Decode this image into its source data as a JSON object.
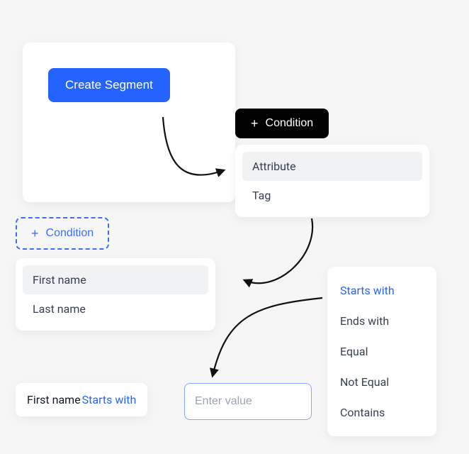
{
  "create_card": {
    "button_label": "Create Segment"
  },
  "black_condition": {
    "label": "Condition",
    "plus": "+"
  },
  "type_menu": {
    "options": [
      "Attribute",
      "Tag"
    ],
    "selected": "Attribute"
  },
  "dashed_condition": {
    "label": "Condition",
    "plus": "+"
  },
  "attribute_menu": {
    "options": [
      "First name",
      "Last name"
    ],
    "selected": "First name"
  },
  "operator_menu": {
    "options": [
      "Starts with",
      "Ends with",
      "Equal",
      "Not Equal",
      "Contains"
    ],
    "selected": "Starts with"
  },
  "summary": {
    "attribute": "First name",
    "operator": "Starts with"
  },
  "value_input": {
    "placeholder": "Enter value",
    "value": ""
  }
}
